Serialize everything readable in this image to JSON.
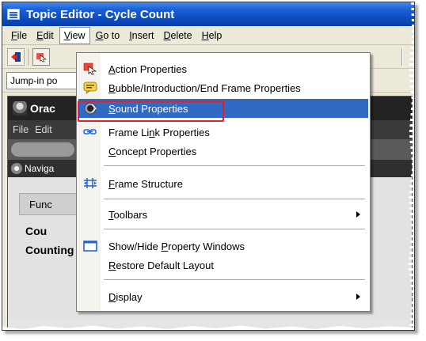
{
  "window": {
    "title": "Topic Editor - Cycle Count"
  },
  "menubar": {
    "items": [
      "File",
      "Edit",
      "View",
      "Go to",
      "Insert",
      "Delete",
      "Help"
    ],
    "accels": [
      "F",
      "E",
      "V",
      "G",
      "I",
      "D",
      "H"
    ]
  },
  "toolbar2": {
    "jump_label": "Jump-in po"
  },
  "inner_app": {
    "title": "Orac",
    "menu": [
      "File",
      "Edit"
    ],
    "nav_label": "Naviga",
    "func_label": "Func",
    "cou_label": "Cou",
    "counting_label": "Counting Menu"
  },
  "view_menu": {
    "items": [
      {
        "label": "Action Properties",
        "icon": "action-properties-icon"
      },
      {
        "label": "Bubble/Introduction/End Frame Properties",
        "icon": "bubble-icon"
      },
      {
        "label": "Sound Properties",
        "icon": "sound-icon",
        "highlighted": true
      },
      {
        "label": "Frame Link Properties",
        "icon": "frame-link-icon"
      },
      {
        "label": "Concept Properties",
        "icon": ""
      },
      {
        "label": "Frame Structure",
        "icon": "frame-structure-icon"
      },
      {
        "label": "Toolbars",
        "icon": "",
        "submenu": true
      },
      {
        "label": "Show/Hide Property Windows",
        "icon": "window-icon"
      },
      {
        "label": "Restore Default Layout",
        "icon": ""
      },
      {
        "label": "Display",
        "icon": "",
        "submenu": true
      }
    ]
  },
  "colors": {
    "titlebar": "#0a4bc0",
    "highlight": "#316ac5",
    "callout": "#e0202a"
  }
}
